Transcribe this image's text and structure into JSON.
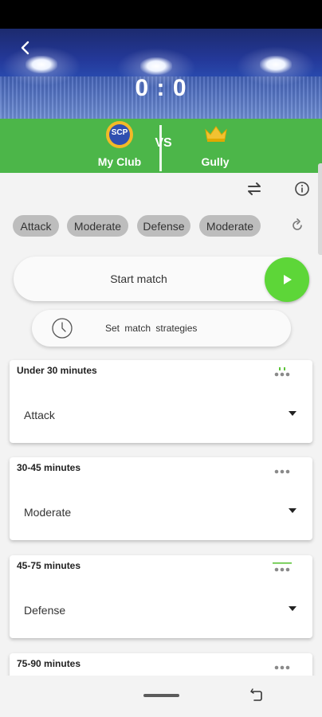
{
  "header": {
    "score": "0 : 0",
    "vs_label": "VS",
    "home_team": {
      "name": "My Club",
      "badge_text": "SCP"
    },
    "away_team": {
      "name": "Gully"
    }
  },
  "tactics": {
    "chips": [
      "Attack",
      "Moderate",
      "Defense",
      "Moderate"
    ]
  },
  "actions": {
    "start_match_label": "Start match",
    "set_strategies_label": "Set  match  strategies"
  },
  "strategies": [
    {
      "title": "Under 30 minutes",
      "value": "Attack"
    },
    {
      "title": "30-45 minutes",
      "value": "Moderate"
    },
    {
      "title": "45-75 minutes",
      "value": "Defense"
    },
    {
      "title": "75-90 minutes",
      "value": ""
    }
  ],
  "colors": {
    "team_bar": "#4cb649",
    "play_button": "#5dd638",
    "chip": "#bdbdbd",
    "accent_green": "#5dc43a"
  },
  "icons": {
    "back": "chevron-left-icon",
    "swap": "swap-arrows-icon",
    "info": "info-icon",
    "reset": "reset-icon",
    "play": "play-icon",
    "clock": "clock-icon",
    "more": "more-dots-icon"
  }
}
